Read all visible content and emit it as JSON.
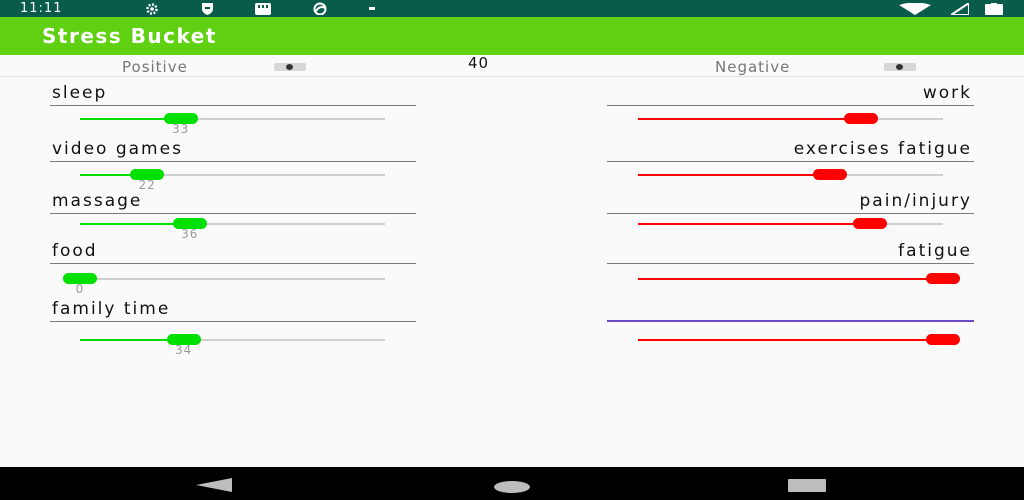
{
  "status_bar": {
    "time": "11:11"
  },
  "app": {
    "title": "Stress Bucket"
  },
  "header": {
    "positive_label": "Positive",
    "negative_label": "Negative",
    "score": "40",
    "positive_toggle_on": false,
    "negative_toggle_on": false
  },
  "positive": [
    {
      "label": "sleep",
      "value": 33,
      "value_text": "33"
    },
    {
      "label": "video games",
      "value": 22,
      "value_text": "22"
    },
    {
      "label": "massage",
      "value": 36,
      "value_text": "36"
    },
    {
      "label": "food",
      "value": 0,
      "value_text": "0"
    },
    {
      "label": "family time",
      "value": 34,
      "value_text": "34"
    }
  ],
  "negative": [
    {
      "label": "work",
      "fraction": 0.73
    },
    {
      "label": "exercises fatigue",
      "fraction": 0.63
    },
    {
      "label": "pain/injury",
      "fraction": 0.76
    },
    {
      "label": "fatigue",
      "fraction": 1.0
    },
    {
      "label": "",
      "fraction": 1.0
    }
  ],
  "colors": {
    "status_bar": "#0a5c4a",
    "app_bar": "#60d012",
    "positive_thumb": "#00e000",
    "negative_thumb": "#ff0000",
    "focus_underline": "#6a4bc4"
  }
}
